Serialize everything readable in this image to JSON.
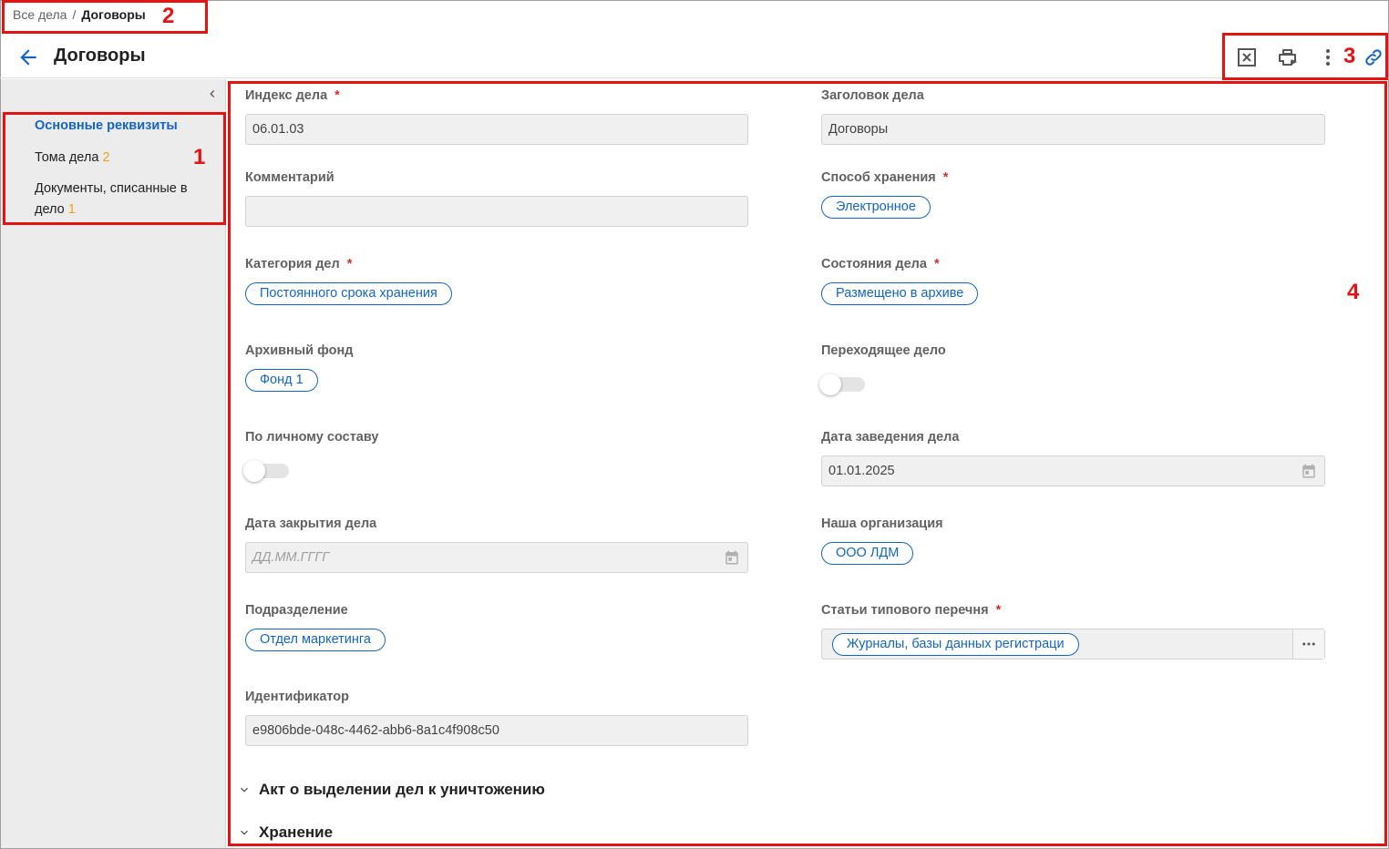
{
  "breadcrumb": {
    "root": "Все дела",
    "separator": "/",
    "current": "Договоры"
  },
  "header": {
    "title": "Договоры"
  },
  "toolbar": {
    "icons": [
      "excel-export-icon",
      "print-preview-icon",
      "more-vert-icon",
      "link-icon"
    ]
  },
  "sidebar": {
    "items": [
      {
        "label": "Основные реквизиты",
        "count": ""
      },
      {
        "label": "Тома дела",
        "count": "2"
      },
      {
        "label": "Документы, списанные в дело",
        "count": "1"
      }
    ]
  },
  "form": {
    "index": {
      "label": "Индекс дела",
      "required": "*",
      "value": "06.01.03"
    },
    "title": {
      "label": "Заголовок дела",
      "value": "Договоры"
    },
    "comment": {
      "label": "Комментарий",
      "value": ""
    },
    "storage_method": {
      "label": "Способ хранения",
      "required": "*",
      "value": "Электронное"
    },
    "category": {
      "label": "Категория дел",
      "required": "*",
      "value": "Постоянного срока хранения"
    },
    "state": {
      "label": "Состояния дела",
      "required": "*",
      "value": "Размещено в архиве"
    },
    "fund": {
      "label": "Архивный фонд",
      "value": "Фонд 1"
    },
    "transitional": {
      "label": "Переходящее дело",
      "on": false
    },
    "personnel": {
      "label": "По личному составу",
      "on": false
    },
    "start_date": {
      "label": "Дата заведения дела",
      "value": "01.01.2025"
    },
    "close_date": {
      "label": "Дата закрытия дела",
      "placeholder": "ДД.ММ.ГГГГ"
    },
    "organization": {
      "label": "Наша организация",
      "value": "ООО ЛДМ"
    },
    "department": {
      "label": "Подразделение",
      "value": "Отдел маркетинга"
    },
    "articles": {
      "label": "Статьи типового перечня",
      "required": "*",
      "value": "Журналы, базы данных регистраци"
    },
    "identifier": {
      "label": "Идентификатор",
      "value": "e9806bde-048c-4462-abb6-8a1c4f908c50"
    }
  },
  "sections": [
    {
      "label": "Акт о выделении дел к уничтожению"
    },
    {
      "label": "Хранение"
    }
  ],
  "annotations": {
    "n1": "1",
    "n2": "2",
    "n3": "3",
    "n4": "4",
    "color": "#e41313"
  },
  "colors": {
    "accent": "#1565c0",
    "required": "#d32f2f",
    "count": "#f0a020"
  }
}
